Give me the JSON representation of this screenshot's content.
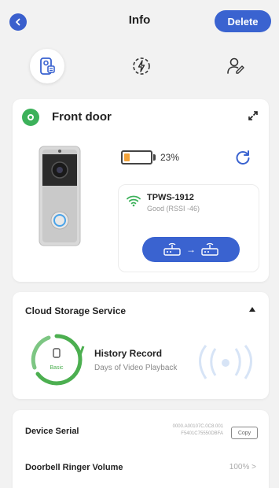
{
  "header": {
    "title": "Info",
    "delete_label": "Delete"
  },
  "icon_tabs": [
    {
      "icon": "device-info-icon",
      "active": true
    },
    {
      "icon": "flash-icon",
      "active": false
    },
    {
      "icon": "user-share-icon",
      "active": false
    }
  ],
  "device": {
    "name": "Front door",
    "battery_text": "23%",
    "battery_level": 0.23,
    "wifi_name": "TPWS-1912",
    "wifi_status": "Good (RSSI -46)"
  },
  "cloud": {
    "title": "Cloud Storage Service",
    "ring_label": "Basic",
    "history_title": "History Record",
    "history_sub": "Days of Video Playback"
  },
  "info": {
    "serial_label": "Device Serial",
    "serial_line1": "0000.A00107C.0C8.001",
    "serial_line2": "F5401C75550DBFA",
    "copy_label": "Copy",
    "volume_label": "Doorbell Ringer Volume",
    "volume_value": "100% >"
  },
  "colors": {
    "accent": "#3a63d0",
    "online_green": "#3cb15a",
    "battery_orange": "#f2a33a"
  }
}
